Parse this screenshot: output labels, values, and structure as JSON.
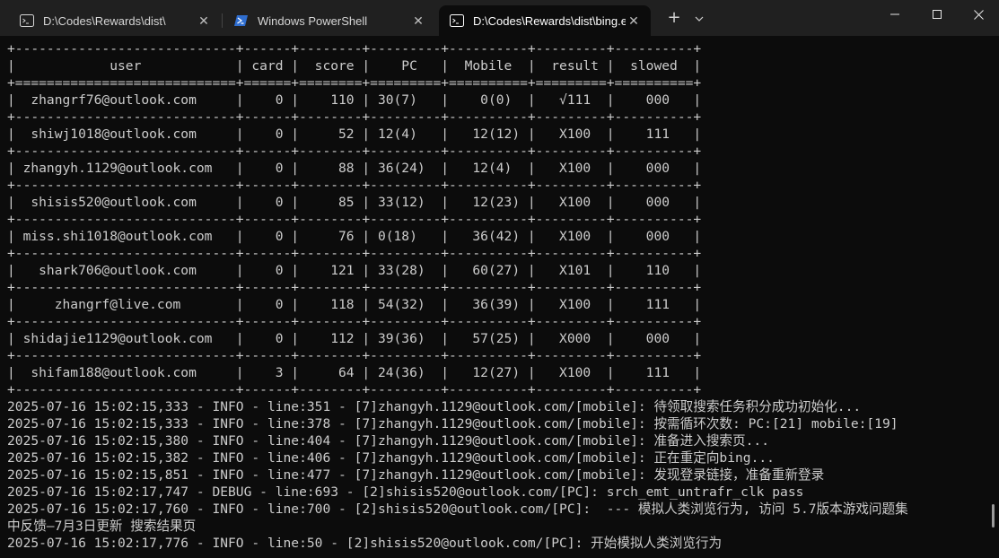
{
  "tabs": [
    {
      "label": "D:\\Codes\\Rewards\\dist\\",
      "icon": "terminal-icon"
    },
    {
      "label": "Windows PowerShell",
      "icon": "powershell-icon"
    },
    {
      "label": "D:\\Codes\\Rewards\\dist\\bing.e",
      "icon": "terminal-icon"
    }
  ],
  "titlebar": {
    "new_tab": "+",
    "dropdown_icon": "chevron-down-icon"
  },
  "window_controls": {
    "minimize": "—",
    "maximize": "☐",
    "close": "✕"
  },
  "table": {
    "border": "+----------------------------+------+--------+---------+----------+---------+----------+",
    "header_border": "+============================+======+========+=========+==========+=========+==========+",
    "header": "|            user            | card |  score |    PC   |  Mobile  |  result |  slowed  |",
    "columns": [
      "user",
      "card",
      "score",
      "PC",
      "Mobile",
      "result",
      "slowed"
    ],
    "rows": [
      "|  zhangrf76@outlook.com     |    0 |    110 | 30(7)   |    0(0)  |   √111  |    000   |",
      "|  shiwj1018@outlook.com     |    0 |     52 | 12(4)   |   12(12) |   X100  |    111   |",
      "| zhangyh.1129@outlook.com   |    0 |     88 | 36(24)  |   12(4)  |   X100  |    000   |",
      "|  shisis520@outlook.com     |    0 |     85 | 33(12)  |   12(23) |   X100  |    000   |",
      "| miss.shi1018@outlook.com   |    0 |     76 | 0(18)   |   36(42) |   X100  |    000   |",
      "|   shark706@outlook.com     |    0 |    121 | 33(28)  |   60(27) |   X101  |    110   |",
      "|     zhangrf@live.com       |    0 |    118 | 54(32)  |   36(39) |   X100  |    111   |",
      "| shidajie1129@outlook.com   |    0 |    112 | 39(36)  |   57(25) |   X000  |    000   |",
      "|  shifam188@outlook.com     |    3 |     64 | 24(36)  |   12(27) |   X100  |    111   |"
    ]
  },
  "logs": [
    "2025-07-16 15:02:15,333 - INFO - line:351 - [7]zhangyh.1129@outlook.com/[mobile]: 待领取搜索任务积分成功初始化...",
    "2025-07-16 15:02:15,333 - INFO - line:378 - [7]zhangyh.1129@outlook.com/[mobile]: 按需循环次数: PC:[21] mobile:[19]",
    "2025-07-16 15:02:15,380 - INFO - line:404 - [7]zhangyh.1129@outlook.com/[mobile]: 准备进入搜索页...",
    "2025-07-16 15:02:15,382 - INFO - line:406 - [7]zhangyh.1129@outlook.com/[mobile]: 正在重定向bing...",
    "2025-07-16 15:02:15,851 - INFO - line:477 - [7]zhangyh.1129@outlook.com/[mobile]: 发现登录链接，准备重新登录",
    "2025-07-16 15:02:17,747 - DEBUG - line:693 - [2]shisis520@outlook.com/[PC]: srch_emt_untrafr_clk pass",
    "2025-07-16 15:02:17,760 - INFO - line:700 - [2]shisis520@outlook.com/[PC]:  --- 模拟人类浏览行为, 访问 5.7版本游戏问题集",
    "中反馈—7月3日更新 搜索结果页",
    "2025-07-16 15:02:17,776 - INFO - line:50 - [2]shisis520@outlook.com/[PC]: 开始模拟人类浏览行为"
  ]
}
